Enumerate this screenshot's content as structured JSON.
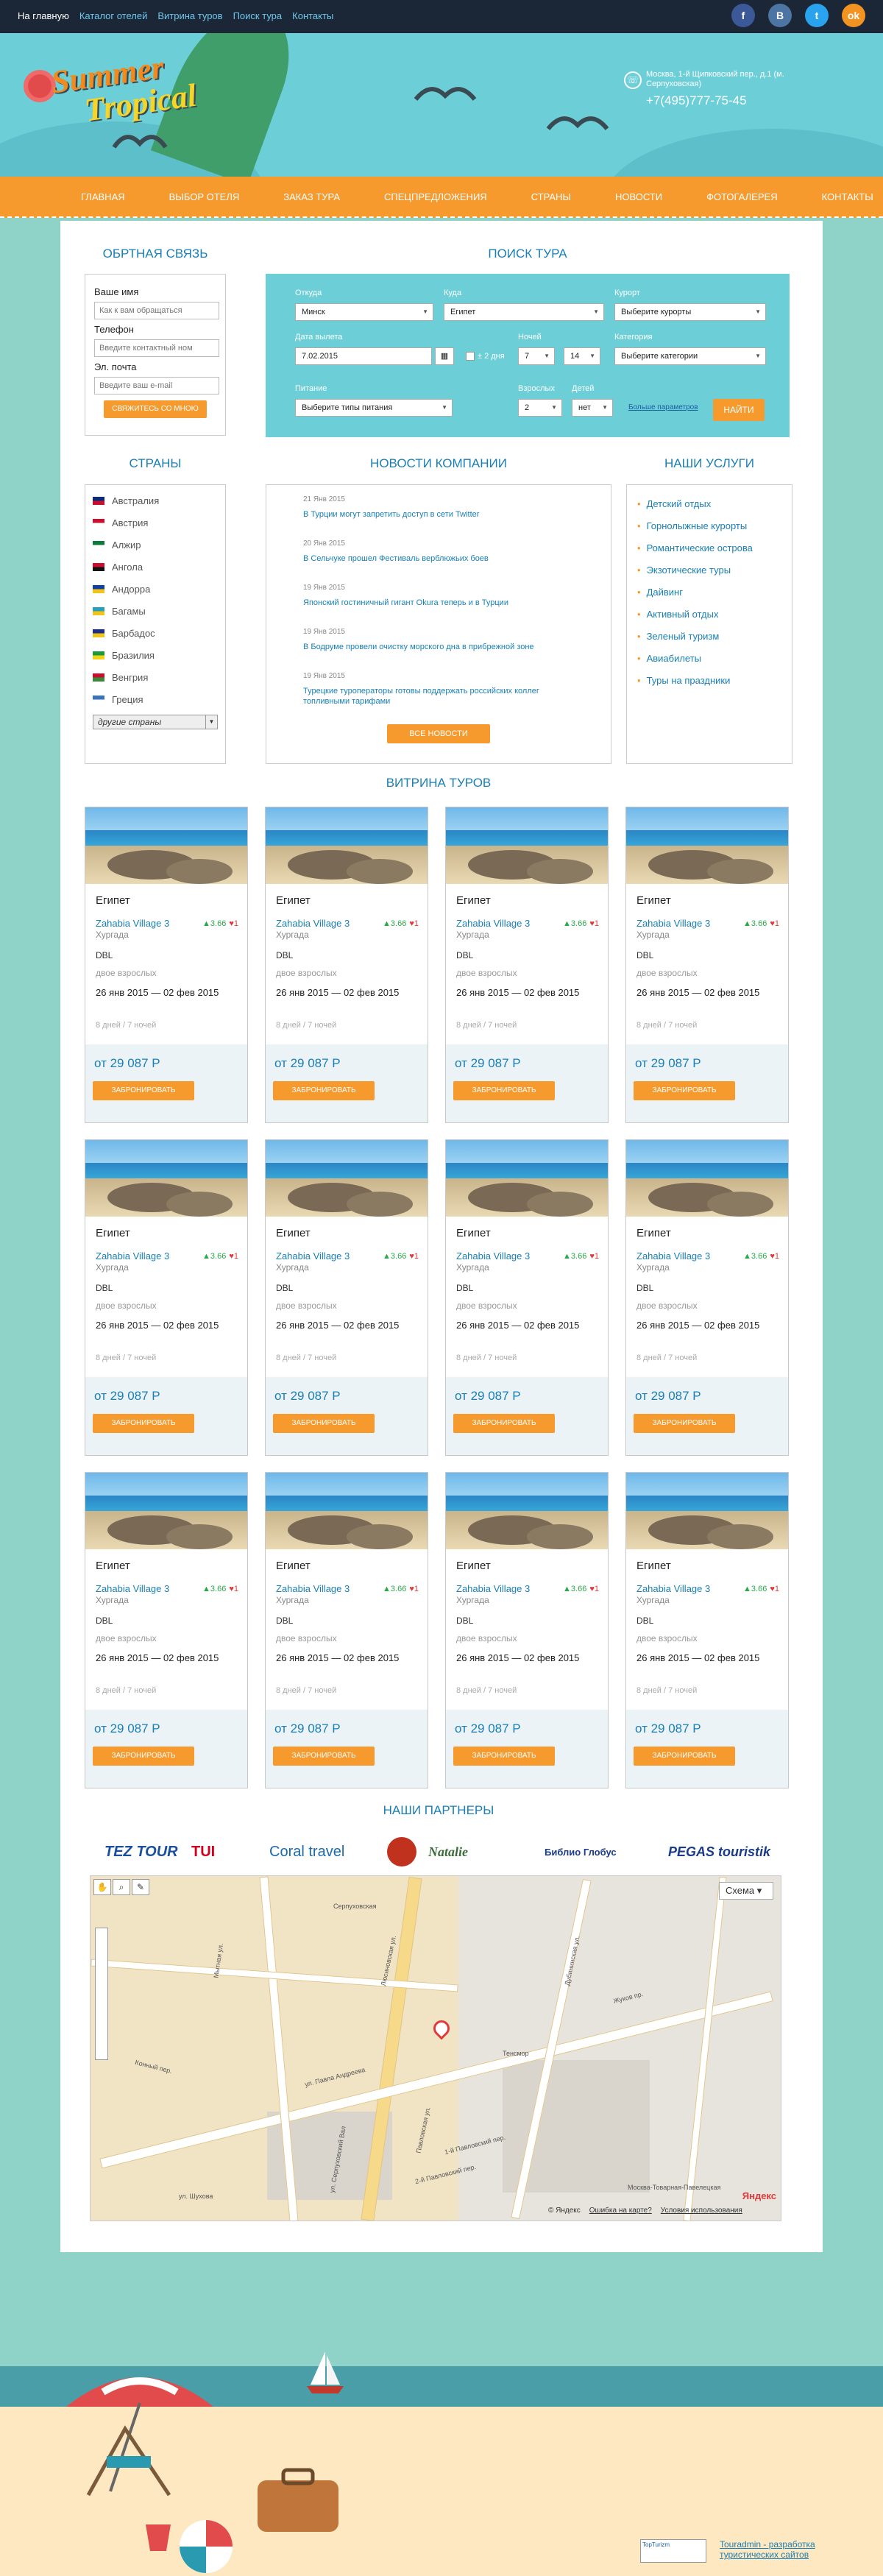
{
  "topnav": {
    "home": "На главную",
    "items": [
      "Каталог отелей",
      "Витрина туров",
      "Поиск тура",
      "Контакты"
    ]
  },
  "socials": [
    {
      "icon": "facebook-icon",
      "glyph": "f",
      "color": "#3b5998"
    },
    {
      "icon": "vk-icon",
      "glyph": "B",
      "color": "#4c75a3"
    },
    {
      "icon": "twitter-icon",
      "glyph": "t",
      "color": "#2aa3ef"
    },
    {
      "icon": "odnoklassniki-icon",
      "glyph": "ok",
      "color": "#f29322"
    }
  ],
  "header": {
    "logo_line1": "Summer",
    "logo_line2": "Tropical",
    "address": "Москва, 1-й Щипковский пер., д.1 (м. Серпуховская)",
    "phone": "+7(495)777-75-45"
  },
  "mainnav": [
    "ГЛАВНАЯ",
    "ВЫБОР ОТЕЛЯ",
    "ЗАКАЗ ТУРА",
    "СПЕЦПРЕДЛОЖЕНИЯ",
    "СТРАНЫ",
    "НОВОСТИ",
    "ФОТОГАЛЕРЕЯ",
    "КОНТАКТЫ"
  ],
  "feedback": {
    "title": "ОБРТНАЯ СВЯЗЬ",
    "name_label": "Ваше имя",
    "name_placeholder": "Как к вам обращаться",
    "phone_label": "Телефон",
    "phone_placeholder": "Введите контактный ном",
    "email_label": "Эл. почта",
    "email_placeholder": "Введите ваш e-mail",
    "submit": "СВЯЖИТЕСЬ СО МНОЮ"
  },
  "search": {
    "title": "ПОИСК ТУРА",
    "from_label": "Откуда",
    "from_value": "Минск",
    "to_label": "Куда",
    "to_value": "Египет",
    "resort_label": "Курорт",
    "resort_value": "Выберите курорты",
    "date_label": "Дата вылета",
    "date_value": "7.02.2015",
    "pm2_label": "± 2 дня",
    "nights_label": "Ночей",
    "nights_from": "7",
    "nights_to": "14",
    "category_label": "Категория",
    "category_value": "Выберите категории",
    "meal_label": "Питание",
    "meal_value": "Выберите типы питания",
    "adults_label": "Взрослых",
    "adults_value": "2",
    "kids_label": "Детей",
    "kids_value": "нет",
    "more_params": "Больше параметров",
    "submit": "НАЙТИ"
  },
  "countries": {
    "title": "СТРАНЫ",
    "items": [
      {
        "name": "Австралия",
        "colors": [
          "#0a2a7a",
          "#c8102e"
        ]
      },
      {
        "name": "Австрия",
        "colors": [
          "#c8102e",
          "#ffffff"
        ]
      },
      {
        "name": "Алжир",
        "colors": [
          "#0b7a3a",
          "#ffffff"
        ]
      },
      {
        "name": "Ангола",
        "colors": [
          "#c8102e",
          "#111111"
        ]
      },
      {
        "name": "Андорра",
        "colors": [
          "#1040a0",
          "#f2c318"
        ]
      },
      {
        "name": "Багамы",
        "colors": [
          "#28a0b8",
          "#f2c318"
        ]
      },
      {
        "name": "Барбадос",
        "colors": [
          "#1a2e8a",
          "#f2c318"
        ]
      },
      {
        "name": "Бразилия",
        "colors": [
          "#1a9a3a",
          "#f2d318"
        ]
      },
      {
        "name": "Венгрия",
        "colors": [
          "#c8102e",
          "#3a8a3a"
        ]
      },
      {
        "name": "Греция",
        "colors": [
          "#3a72c0",
          "#ffffff"
        ]
      }
    ],
    "other": "другие страны"
  },
  "news": {
    "title": "НОВОСТИ КОМПАНИИ",
    "items": [
      {
        "date": "21 Янв 2015",
        "text": "В Турции могут запретить доступ в сети Twitter"
      },
      {
        "date": "20 Янв 2015",
        "text": "В Сельчуке прошел Фестиваль верблюжьих боев"
      },
      {
        "date": "19 Янв 2015",
        "text": "Японский гостиничный гигант Okura теперь и в Турции"
      },
      {
        "date": "19 Янв 2015",
        "text": "В Бодруме провели очистку морского дна в прибрежной зоне"
      },
      {
        "date": "19 Янв 2015",
        "text": "Турецкие туроператоры готовы поддержать российских коллег топливными тарифами"
      }
    ],
    "all_button": "ВСЕ НОВОСТИ"
  },
  "services": {
    "title": "НАШИ УСЛУГИ",
    "items": [
      "Детский отдых",
      "Горнолыжные курорты",
      "Романтические острова",
      "Экзотические туры",
      "Дайвинг",
      "Активный отдых",
      "Зеленый туризм",
      "Авиабилеты",
      "Туры на праздники"
    ]
  },
  "showcase": {
    "title": "ВИТРИНА ТУРОВ",
    "card": {
      "country": "Египет",
      "hotel": "Zahabia Village 3",
      "rating": "3.66",
      "likes": "1",
      "city": "Хургада",
      "room": "DBL",
      "adults": "двое взрослых",
      "dates": "26 янв 2015 — 02 фев 2015",
      "nights": "8 дней / 7 ночей",
      "price": "от 29 087 Р",
      "book": "ЗАБРОНИРОВАТЬ"
    }
  },
  "partners": {
    "title": "НАШИ ПАРТНЕРЫ",
    "items": [
      "TEZ TOUR",
      "TUI",
      "Coral travel",
      "Natalie",
      "Библио Глобус",
      "PEGAS touristik"
    ]
  },
  "map": {
    "scheme": "Схема",
    "labels": [
      "ул. Павла Андреева",
      "Павловская ул.",
      "2-й Павловский пер.",
      "1-й Павловский пер.",
      "Серпуховская",
      "Тенсмор",
      "Жуков пр.",
      "Дубининская ул.",
      "Люсиновская ул.",
      "Мытная ул.",
      "Конный пер.",
      "ул. Шухова",
      "ул. Серпуховский Вал",
      "Москва-Товарная-Павелецкая"
    ],
    "copyright": "© Яндекс",
    "error_link": "Ошибка на карте?",
    "terms_link": "Условия использования",
    "brand": "Яндекс"
  },
  "footer": {
    "credit": "Touradmin - разработка туристических сайтов",
    "counter": "TopTurizm"
  }
}
